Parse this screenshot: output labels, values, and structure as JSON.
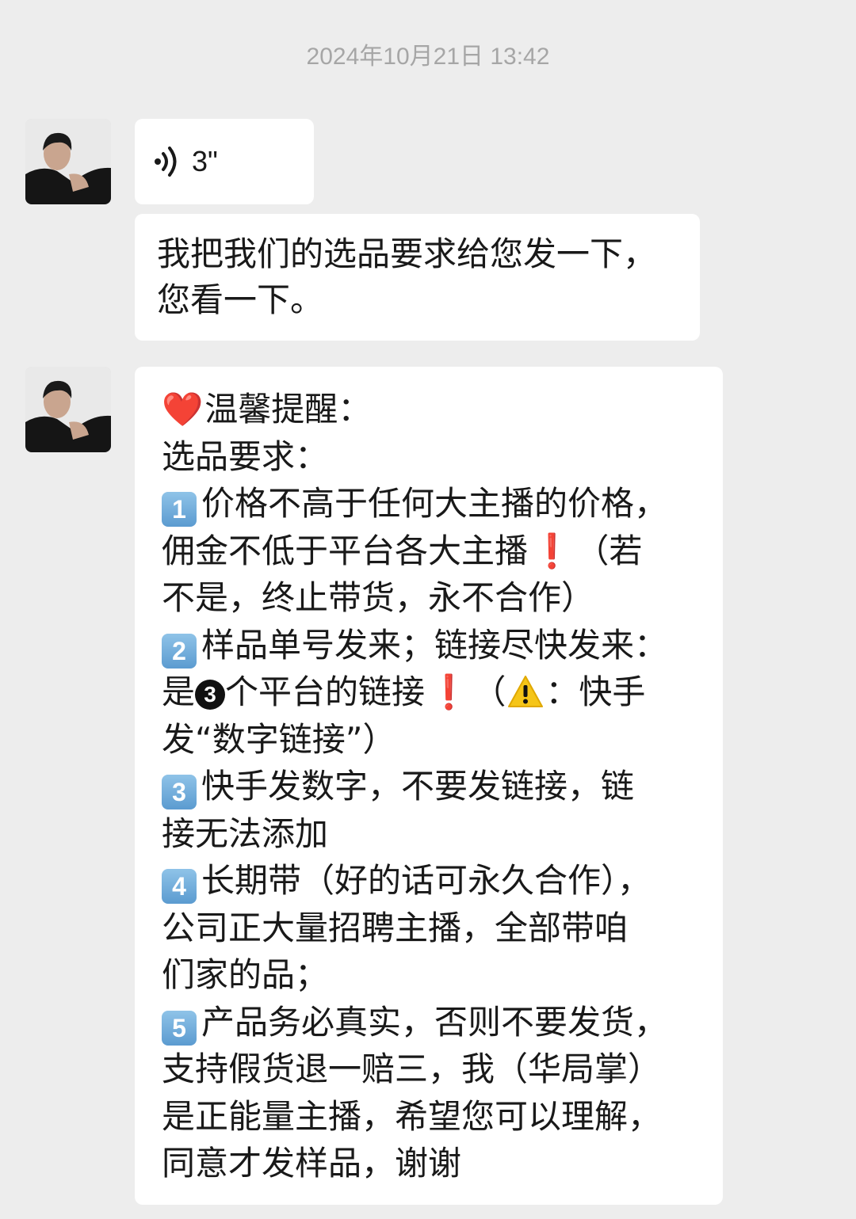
{
  "timestamp": "2024年10月21日 13:42",
  "messages": [
    {
      "type": "voice",
      "duration": "3\"",
      "icon": "voice-wave-icon"
    },
    {
      "type": "text",
      "lines": [
        "我把我们的选品要求给您发一下，",
        "您看一下。"
      ]
    },
    {
      "type": "text",
      "header_emoji": "❤️",
      "title": "温馨提醒：",
      "subtitle": "选品要求：",
      "item1": {
        "number": "1",
        "line1": "价格不高于任何大主播的价格，",
        "line2a": "佣金不低于平台各大主播",
        "line2_mark": "❗",
        "line2b": "（若",
        "line3": "不是，终止带货，永不合作）"
      },
      "item2": {
        "number": "2",
        "line1": "样品单号发来；链接尽快发来：",
        "line2a": "是",
        "line2_circled": "3",
        "line2b": "个平台的链接",
        "line2_mark": "❗",
        "line2c": "（",
        "line2_warn": "warning-icon",
        "line2d": "：快手",
        "line3": "发“数字链接”）"
      },
      "item3": {
        "number": "3",
        "line1": "快手发数字，不要发链接，链",
        "line2": "接无法添加"
      },
      "item4": {
        "number": "4",
        "line1": "长期带（好的话可永久合作），",
        "line2": "公司正大量招聘主播，全部带咱",
        "line3": "们家的品；"
      },
      "item5": {
        "number": "5",
        "line1": "产品务必真实，否则不要发货，",
        "line2": "支持假货退一赔三，我（华局掌）",
        "line3": "是正能量主播，希望您可以理解，",
        "line4": "同意才发样品，谢谢"
      }
    }
  ],
  "colors": {
    "background": "#ededed",
    "bubble": "#ffffff",
    "timestamp": "#a6a6a6",
    "text": "#191919",
    "alert_red": "#e02121",
    "keycap_blue": "#5b9bd0"
  }
}
